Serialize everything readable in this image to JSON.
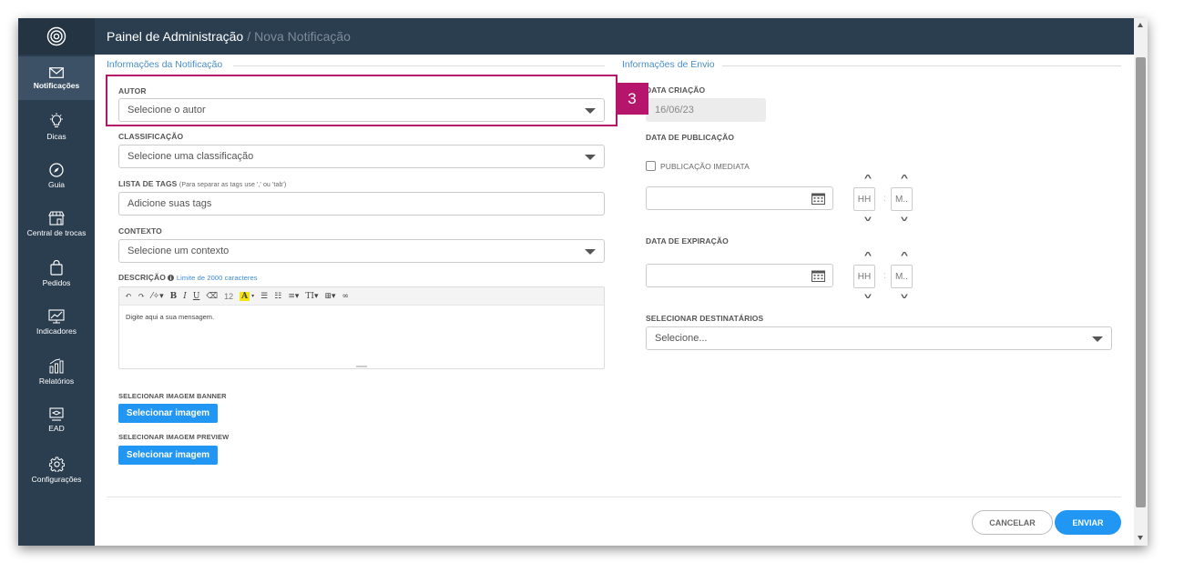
{
  "header": {
    "title": "Painel de Administração",
    "separator": "/",
    "subtitle": "Nova Notificação"
  },
  "sidebar": {
    "logo_icon": "target-logo-icon",
    "items": [
      {
        "label": "Notificações",
        "icon": "envelope-icon",
        "active": true
      },
      {
        "label": "Dicas",
        "icon": "lightbulb-icon",
        "active": false
      },
      {
        "label": "Guia",
        "icon": "compass-icon",
        "active": false
      },
      {
        "label": "Central de trocas",
        "icon": "store-icon",
        "active": false
      },
      {
        "label": "Pedidos",
        "icon": "shopping-bag-icon",
        "active": false
      },
      {
        "label": "Indicadores",
        "icon": "chart-icon",
        "active": false
      },
      {
        "label": "Relatórios",
        "icon": "report-icon",
        "active": false
      },
      {
        "label": "EAD",
        "icon": "elearning-icon",
        "active": false
      },
      {
        "label": "Configurações",
        "icon": "gear-icon",
        "active": false
      }
    ]
  },
  "notification_info": {
    "section_title": "Informações da Notificação",
    "author": {
      "label": "AUTOR",
      "value": "Selecione o autor"
    },
    "classification": {
      "label": "CLASSIFICAÇÃO",
      "value": "Selecione uma classificação"
    },
    "tags": {
      "label": "LISTA DE TAGS",
      "hint": "(Para separar as tags use ',' ou 'tab')",
      "placeholder": "Adicione suas tags"
    },
    "context": {
      "label": "CONTEXTO",
      "value": "Selecione um contexto"
    },
    "description": {
      "label": "DESCRIÇÃO",
      "limit_text": "Limite de 2000 caracteres",
      "font_size": "12",
      "placeholder": "Digite aqui a sua mensagem."
    },
    "banner": {
      "label": "SELECIONAR IMAGEM BANNER",
      "button": "Selecionar imagem"
    },
    "preview": {
      "label": "SELECIONAR IMAGEM PREVIEW",
      "button": "Selecionar imagem"
    }
  },
  "send_info": {
    "section_title": "Informações de Envio",
    "creation_date": {
      "label": "DATA CRIAÇÃO",
      "value": "16/06/23"
    },
    "publication_date": {
      "label": "DATA DE PUBLICAÇÃO",
      "immediate_label": "PUBLICAÇÃO IMEDIATA",
      "hour_placeholder": "HH",
      "minute_placeholder": "M.."
    },
    "expiration_date": {
      "label": "DATA DE EXPIRAÇÃO",
      "hour_placeholder": "HH",
      "minute_placeholder": "M.."
    },
    "recipients": {
      "label": "SELECIONAR DESTINATÁRIOS",
      "value": "Selecione..."
    }
  },
  "annotation": {
    "step_number": "3",
    "color": "#b5166b"
  },
  "footer": {
    "cancel_label": "CANCELAR",
    "send_label": "ENVIAR"
  },
  "colors": {
    "sidebar": "#2b3e50",
    "accent": "#2196f3",
    "section_title": "#4a8ec9"
  }
}
